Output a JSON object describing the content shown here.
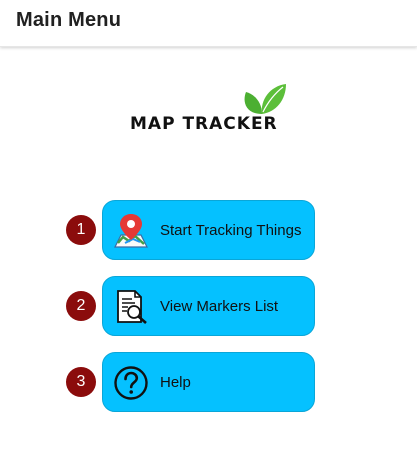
{
  "appbar": {
    "title": "Main Menu"
  },
  "logo": {
    "text": "MAP TRACKER",
    "leaf_color": "#4caf32"
  },
  "menu": {
    "items": [
      {
        "badge": "1",
        "label": "Start Tracking Things",
        "icon": "map-pin-icon"
      },
      {
        "badge": "2",
        "label": "View Markers List",
        "icon": "document-search-icon"
      },
      {
        "badge": "3",
        "label": "Help",
        "icon": "help-icon"
      }
    ]
  },
  "colors": {
    "button_fill": "#05c1ff",
    "badge_fill": "#8b0c0c",
    "pin_red": "#e53935"
  }
}
